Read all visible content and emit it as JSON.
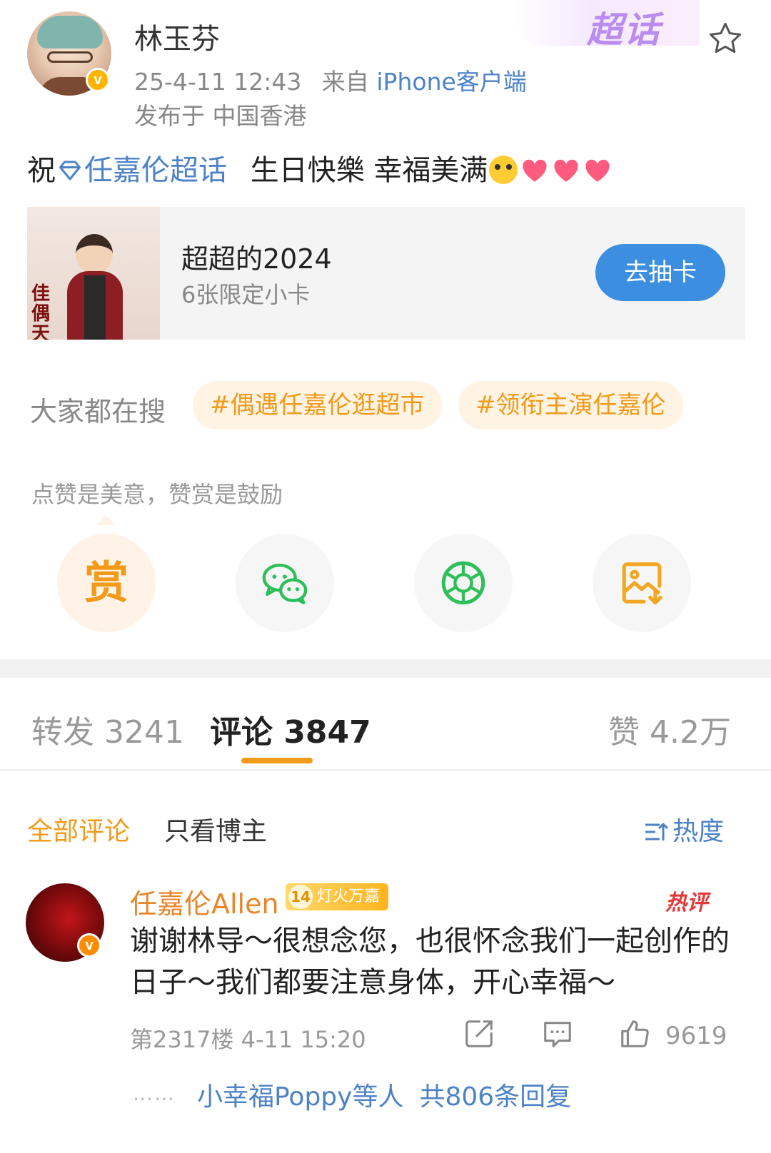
{
  "header": {
    "badge": "超话",
    "username": "林玉芬",
    "timestamp": "25-4-11 12:43",
    "source_prefix": "来自",
    "source": "iPhone客户端",
    "location": "发布于 中国香港"
  },
  "post": {
    "text_before": "祝",
    "topic": "任嘉伦超话",
    "text_after": "生日快樂 幸福美满"
  },
  "card": {
    "calligraphy": "佳偶天成",
    "title": "超超的2024",
    "subtitle": "6张限定小卡",
    "button": "去抽卡"
  },
  "search": {
    "label": "大家都在搜",
    "tags": [
      "#偶遇任嘉伦逛超市",
      "#领衔主演任嘉伦"
    ]
  },
  "reward": {
    "tip": "点赞是美意，赞赏是鼓励",
    "reward_glyph": "赏"
  },
  "tabs": {
    "forward": "转发 3241",
    "comment": "评论 3847",
    "like": "赞 4.2万"
  },
  "filters": {
    "all": "全部评论",
    "author": "只看博主",
    "sort": "热度"
  },
  "comment": {
    "name": "任嘉伦Allen",
    "fan_level": "14",
    "fan_title": "灯火万嘉",
    "hot": "热评",
    "text": "谢谢林导～很想念您，也很怀念我们一起创作的日子～我们都要注意身体，开心幸福～",
    "meta": "第2317楼 4-11 15:20",
    "likes": "9619",
    "replies_users": "小幸福Poppy等人",
    "replies_total": "共806条回复"
  },
  "colors": {
    "link_blue": "#4d82c7",
    "accent_orange": "#f29a1a",
    "button_blue": "#3c8fe0"
  }
}
